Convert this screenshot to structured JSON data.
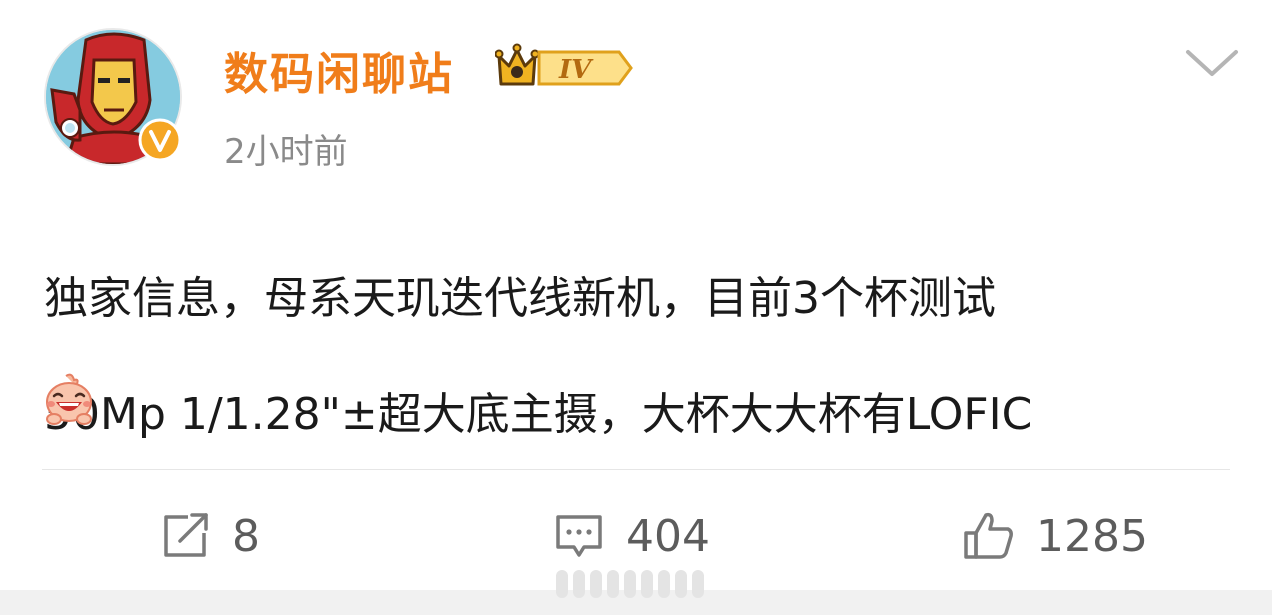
{
  "post": {
    "author": {
      "name": "数码闲聊站",
      "level": "IV",
      "verified": "V"
    },
    "timestamp": "2小时前",
    "content_lines": [
      "独家信息，母系天玑迭代线新机，目前3个杯测试",
      "50Mp 1/1.28\"±超大底主摄，大杯大大杯有LOFIC"
    ],
    "emoji_icon": "laughing-face-emoji"
  },
  "actions": {
    "repost": {
      "icon": "repost-icon",
      "count": "8"
    },
    "comment": {
      "icon": "comment-icon",
      "count": "404"
    },
    "like": {
      "icon": "thumbs-up-icon",
      "count": "1285"
    }
  },
  "colors": {
    "username": "#f07d1a",
    "timestamp": "#8a8a8a",
    "action_icon": "#7a7a7a",
    "verified_badge": "#f5a623"
  }
}
